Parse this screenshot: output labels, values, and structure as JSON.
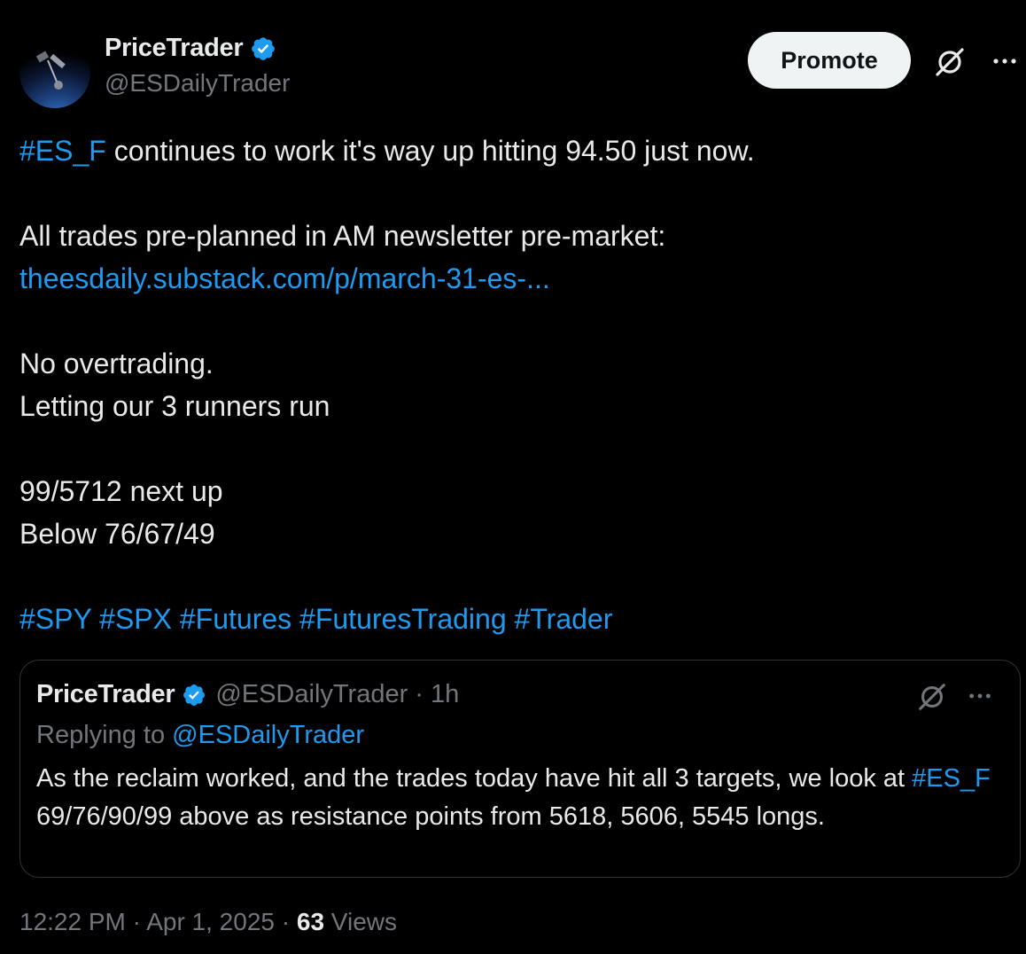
{
  "author": {
    "display_name": "PriceTrader",
    "handle": "@ESDailyTrader"
  },
  "actions": {
    "promote_label": "Promote"
  },
  "tweet": {
    "line1_tag": "#ES_F",
    "line1_text": " continues to work it's way up hitting 94.50 just now.",
    "line2": "All trades pre-planned in AM newsletter pre-market:",
    "link": "theesdaily.substack.com/p/march-31-es-...",
    "line3": "No overtrading.",
    "line4": "Letting our 3 runners run",
    "line5": "99/5712 next up",
    "line6": "Below 76/67/49",
    "hashtags": [
      "#SPY",
      "#SPX",
      "#Futures",
      "#FuturesTrading",
      "#Trader"
    ]
  },
  "quoted": {
    "display_name": "PriceTrader",
    "meta": "@ESDailyTrader · 1h",
    "replying_prefix": "Replying to ",
    "replying_handle": "@ESDailyTrader",
    "text_part1": "As the reclaim worked, and the trades today have hit all 3 targets, we look at ",
    "text_tag": "#ES_F",
    "text_part2": " 69/76/90/99 above as resistance points from 5618, 5606, 5545 longs."
  },
  "footer": {
    "time": "12:22 PM",
    "sep1": " · ",
    "date": "Apr 1, 2025",
    "sep2": " · ",
    "views_count": "63",
    "views_label": " Views"
  },
  "colors": {
    "background": "#000000",
    "text": "#e7e9ea",
    "muted": "#71767b",
    "link": "#1d9bf0",
    "verified": "#1d9bf0",
    "border": "#2f3336"
  },
  "icons": {
    "verified": "verified-badge-icon",
    "grok": "grok-icon",
    "more": "more-dots-icon"
  }
}
